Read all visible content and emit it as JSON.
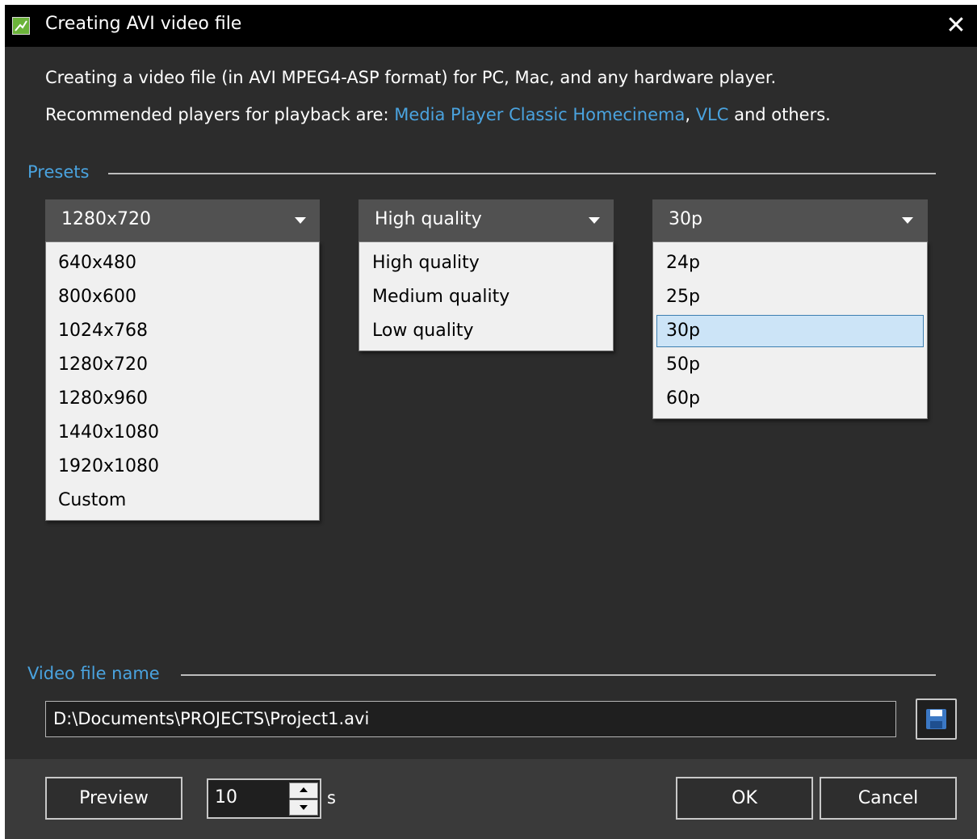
{
  "window": {
    "title": "Creating AVI video file",
    "close_glyph": "✕",
    "app_icon": "app-icon"
  },
  "info": {
    "line1": "Creating a video file (in AVI MPEG4-ASP format) for PC, Mac, and any hardware player.",
    "line2_prefix": "Recommended players for playback are: ",
    "link1": "Media Player Classic Homecinema",
    "separator": ", ",
    "link2": "VLC",
    "line2_suffix": " and others."
  },
  "presets": {
    "label": "Presets",
    "resolution": {
      "selected": "1280x720",
      "options": [
        "640x480",
        "800x600",
        "1024x768",
        "1280x720",
        "1280x960",
        "1440x1080",
        "1920x1080",
        "Custom"
      ]
    },
    "quality": {
      "selected": "High quality",
      "options": [
        "High quality",
        "Medium quality",
        "Low quality"
      ]
    },
    "framerate": {
      "selected": "30p",
      "options": [
        "24p",
        "25p",
        "30p",
        "50p",
        "60p"
      ],
      "highlighted": "30p"
    }
  },
  "video_file": {
    "label": "Video file name",
    "path": "D:\\Documents\\PROJECTS\\Project1.avi",
    "save_icon": "save-icon"
  },
  "footer": {
    "preview_label": "Preview",
    "duration_value": "10",
    "duration_unit": "s",
    "ok_label": "OK",
    "cancel_label": "Cancel"
  },
  "colors": {
    "accent_link": "#4aa3df",
    "dialog_bg": "#2c2c2c",
    "titlebar_bg": "#000000",
    "selection_bg": "#cce4f7"
  }
}
